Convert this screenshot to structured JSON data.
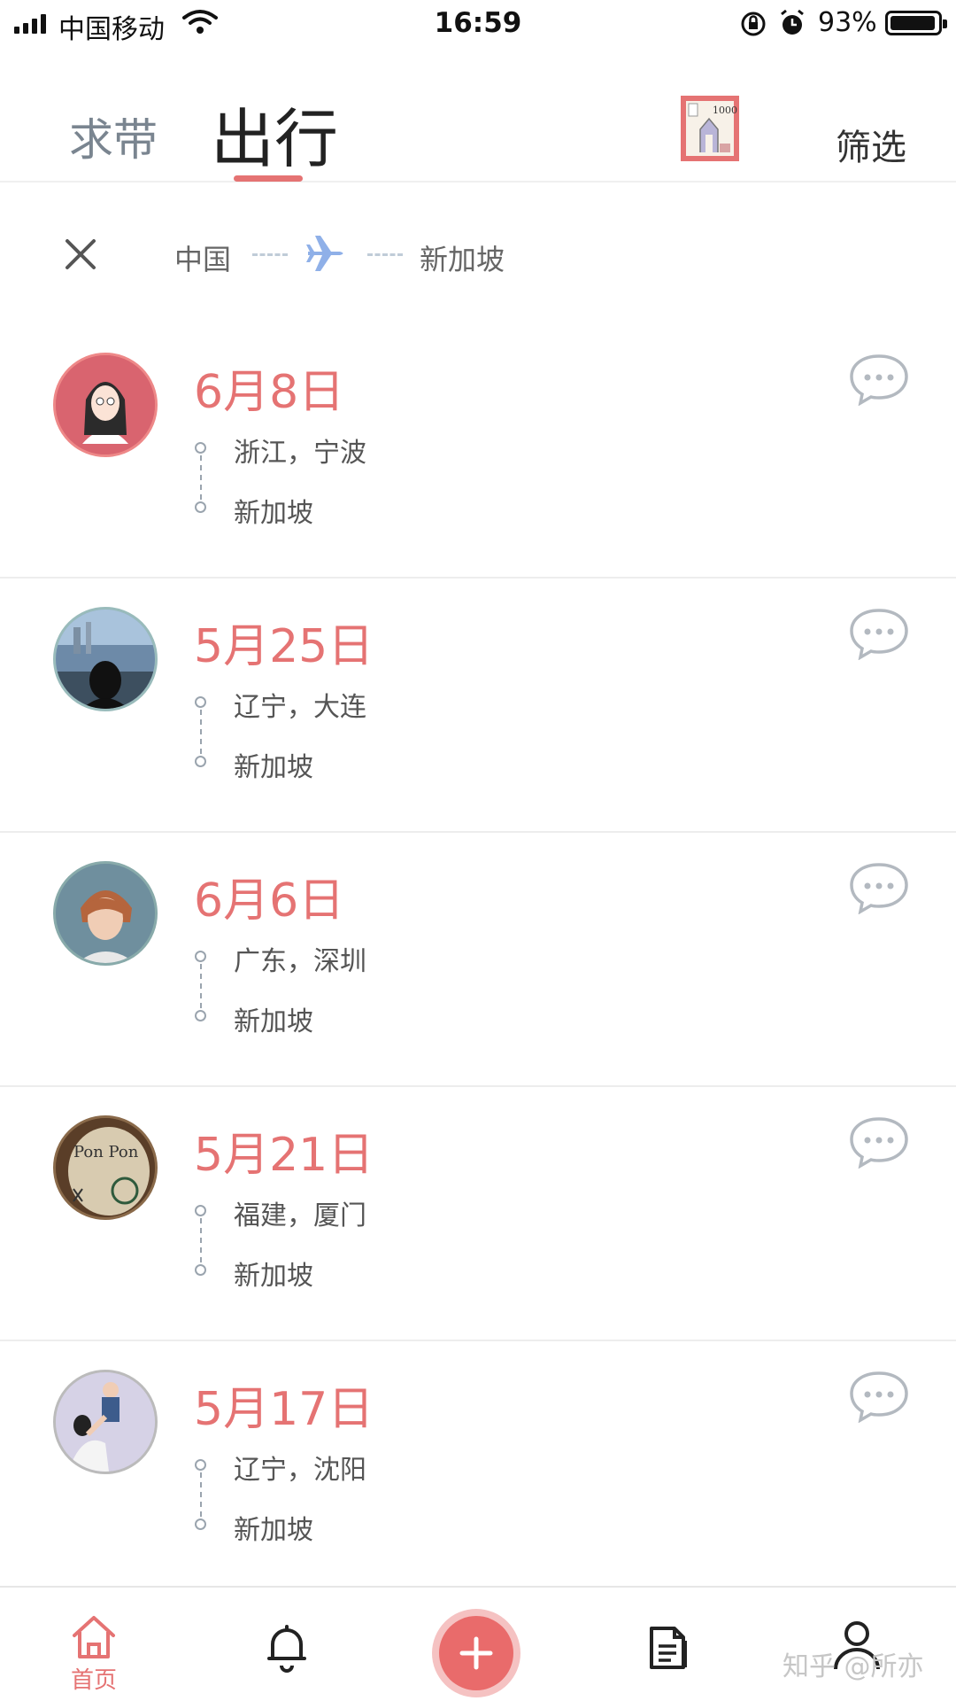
{
  "status_bar": {
    "carrier": "中国移动",
    "time": "16:59",
    "battery": "93%"
  },
  "header": {
    "tab_qiudai": "求带",
    "tab_chuxing": "出行",
    "filter": "筛选",
    "stamp_icon": "stamp-icon"
  },
  "route": {
    "from": "中国",
    "to": "新加坡",
    "icon": "plane-icon"
  },
  "trips": [
    {
      "date": "6月8日",
      "origin": "浙江，宁波",
      "destination": "新加坡"
    },
    {
      "date": "5月25日",
      "origin": "辽宁，大连",
      "destination": "新加坡"
    },
    {
      "date": "6月6日",
      "origin": "广东，深圳",
      "destination": "新加坡"
    },
    {
      "date": "5月21日",
      "origin": "福建，厦门",
      "destination": "新加坡"
    },
    {
      "date": "5月17日",
      "origin": "辽宁，沈阳",
      "destination": "新加坡"
    }
  ],
  "bottom_nav": {
    "home_label": "首页"
  },
  "watermark": "知乎 @所亦",
  "colors": {
    "accent": "#e57373",
    "plane": "#8fb0e8"
  }
}
